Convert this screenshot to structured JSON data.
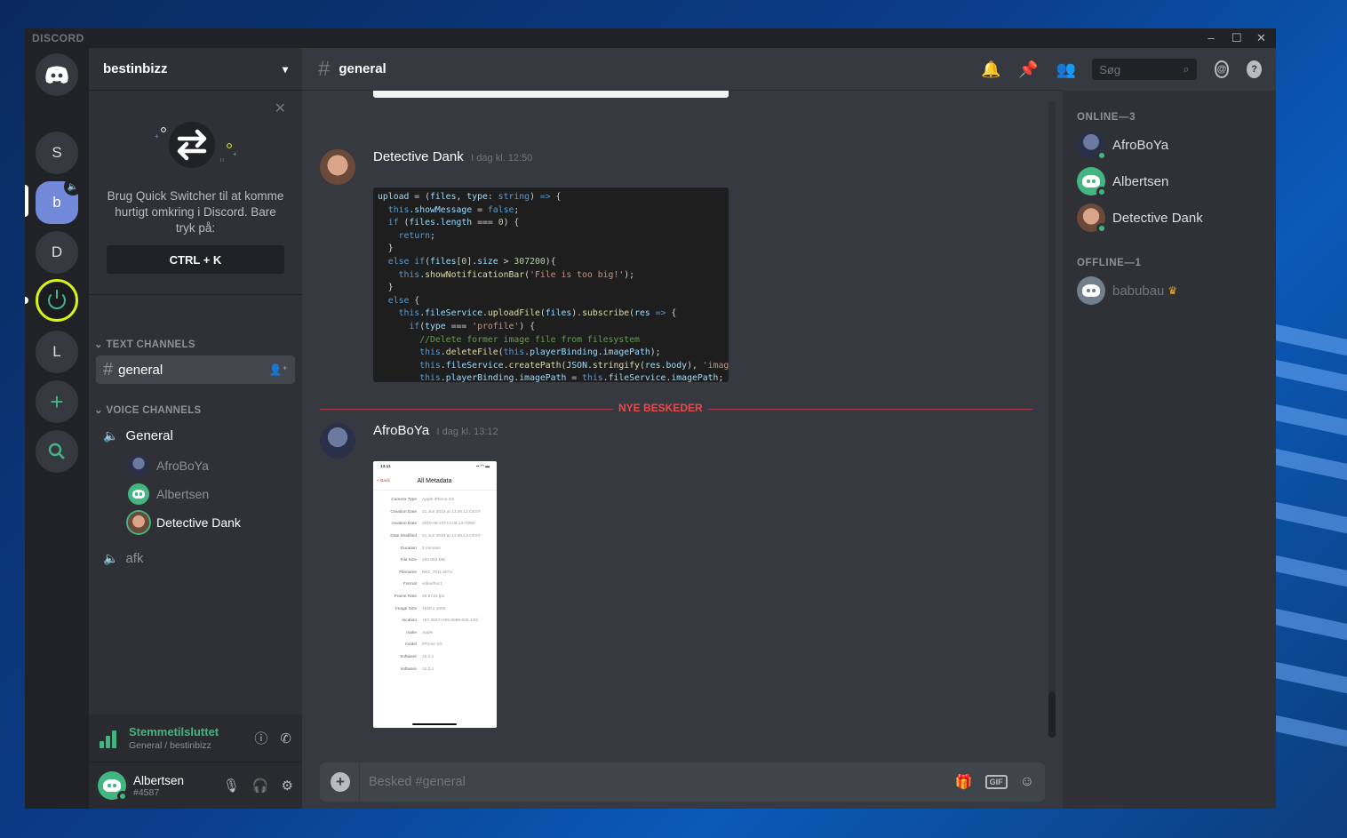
{
  "window": {
    "brand": "DISCORD",
    "minimize": "–",
    "maximize": "☐",
    "close": "✕"
  },
  "servers": [
    {
      "label": "S"
    },
    {
      "label": "b"
    },
    {
      "label": "D"
    },
    {
      "label": "L"
    }
  ],
  "sidebar": {
    "guild_name": "bestinbizz",
    "quick_switcher": {
      "text": "Brug Quick Switcher til at komme hurtigt omkring i Discord. Bare tryk på:",
      "shortcut": "CTRL + K"
    },
    "text_category": "TEXT CHANNELS",
    "text_channels": [
      {
        "name": "general"
      }
    ],
    "voice_category": "VOICE CHANNELS",
    "voice_channels": [
      {
        "name": "General"
      },
      {
        "name": "afk"
      }
    ],
    "voice_users": [
      {
        "name": "AfroBoYa"
      },
      {
        "name": "Albertsen"
      },
      {
        "name": "Detective Dank"
      }
    ],
    "voice_status": {
      "title": "Stemmetilsluttet",
      "subtitle": "General / bestinbizz"
    },
    "user": {
      "name": "Albertsen",
      "tag": "#4587"
    }
  },
  "chat": {
    "channel": "general",
    "search_placeholder": "Søg",
    "messages": [
      {
        "author": "Detective Dank",
        "time": "I dag kl. 12:50"
      },
      {
        "author": "AfroBoYa",
        "time": "I dag kl. 13:12"
      }
    ],
    "new_messages_label": "NYE BESKEDER",
    "composer_placeholder": "Besked #general",
    "gif_label": "GIF"
  },
  "screenshot_phone": {
    "status_time": "13.11",
    "back": "< Back",
    "title": "All Metadata",
    "rows": [
      {
        "key": "Camera Type",
        "value": "Apple iPhone XS"
      },
      {
        "key": "Creation Date",
        "value": "21 Jun 2019 at 13.06.13 CEST"
      },
      {
        "key": "creation Date",
        "value": "2019-06-21T13:06:13+0200"
      },
      {
        "key": "Date Modified",
        "value": "21 Jun 2019 at 13.06.13 CEST"
      },
      {
        "key": "Duration",
        "value": "2 minutes"
      },
      {
        "key": "File Size",
        "value": "100.092 MB"
      },
      {
        "key": "Filename",
        "value": "IMG_7011.MOV"
      },
      {
        "key": "Format",
        "value": "video/hvc1"
      },
      {
        "key": "Frame Rate",
        "value": "29.9734 fps"
      },
      {
        "key": "Image Size",
        "value": "1920 x 1080"
      },
      {
        "key": "location",
        "value": "+57.0507+009.9099-000.440/"
      },
      {
        "key": "make",
        "value": "Apple"
      },
      {
        "key": "model",
        "value": "iPhone XS"
      },
      {
        "key": "Software",
        "value": "12.3.1"
      },
      {
        "key": "software",
        "value": "12.3.1"
      }
    ]
  },
  "members": {
    "online_header": "ONLINE—3",
    "online": [
      {
        "name": "AfroBoYa"
      },
      {
        "name": "Albertsen"
      },
      {
        "name": "Detective Dank"
      }
    ],
    "offline_header": "OFFLINE—1",
    "offline": [
      {
        "name": "babubau"
      }
    ]
  },
  "colors": {
    "accent": "#7289da",
    "online": "#43b581",
    "new_messages": "#f04747",
    "speaking_ring": "#d8f21a"
  },
  "icons": [
    "discord-home-icon",
    "add-server-icon",
    "explore-icon",
    "bell-icon",
    "pin-icon",
    "members-icon",
    "search-icon",
    "mentions-icon",
    "help-icon",
    "gift-icon",
    "emoji-icon",
    "mic-icon",
    "headphones-icon",
    "settings-icon",
    "info-icon",
    "disconnect-icon"
  ]
}
